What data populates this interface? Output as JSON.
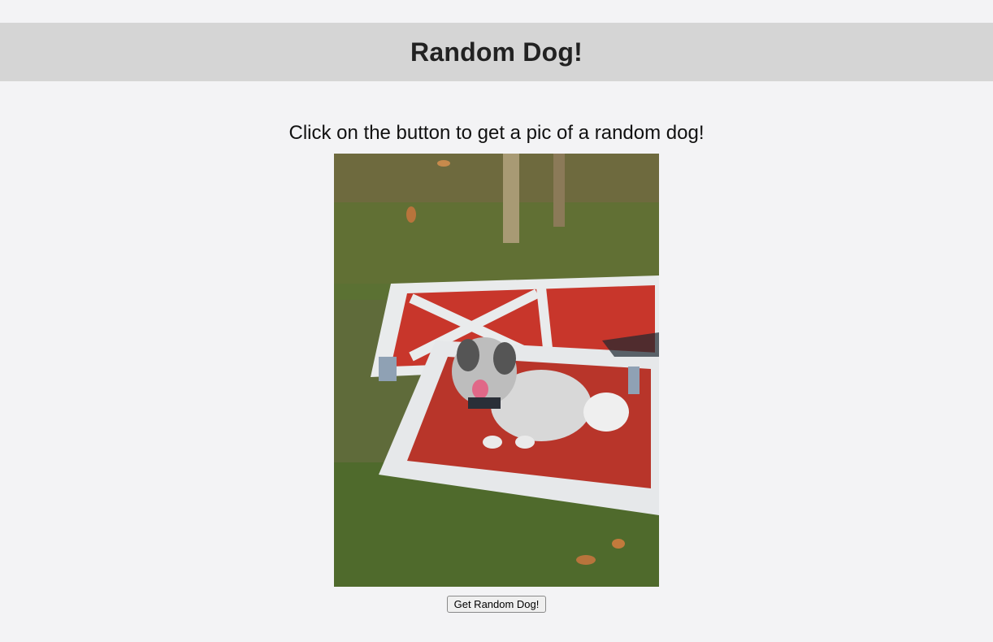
{
  "header": {
    "title": "Random Dog!"
  },
  "main": {
    "prompt": "Click on the button to get a pic of a random dog!",
    "image": {
      "alt": "random dog"
    },
    "button_label": "Get Random Dog!"
  },
  "colors": {
    "page_background": "#f3f3f5",
    "header_background": "#d5d5d5"
  }
}
